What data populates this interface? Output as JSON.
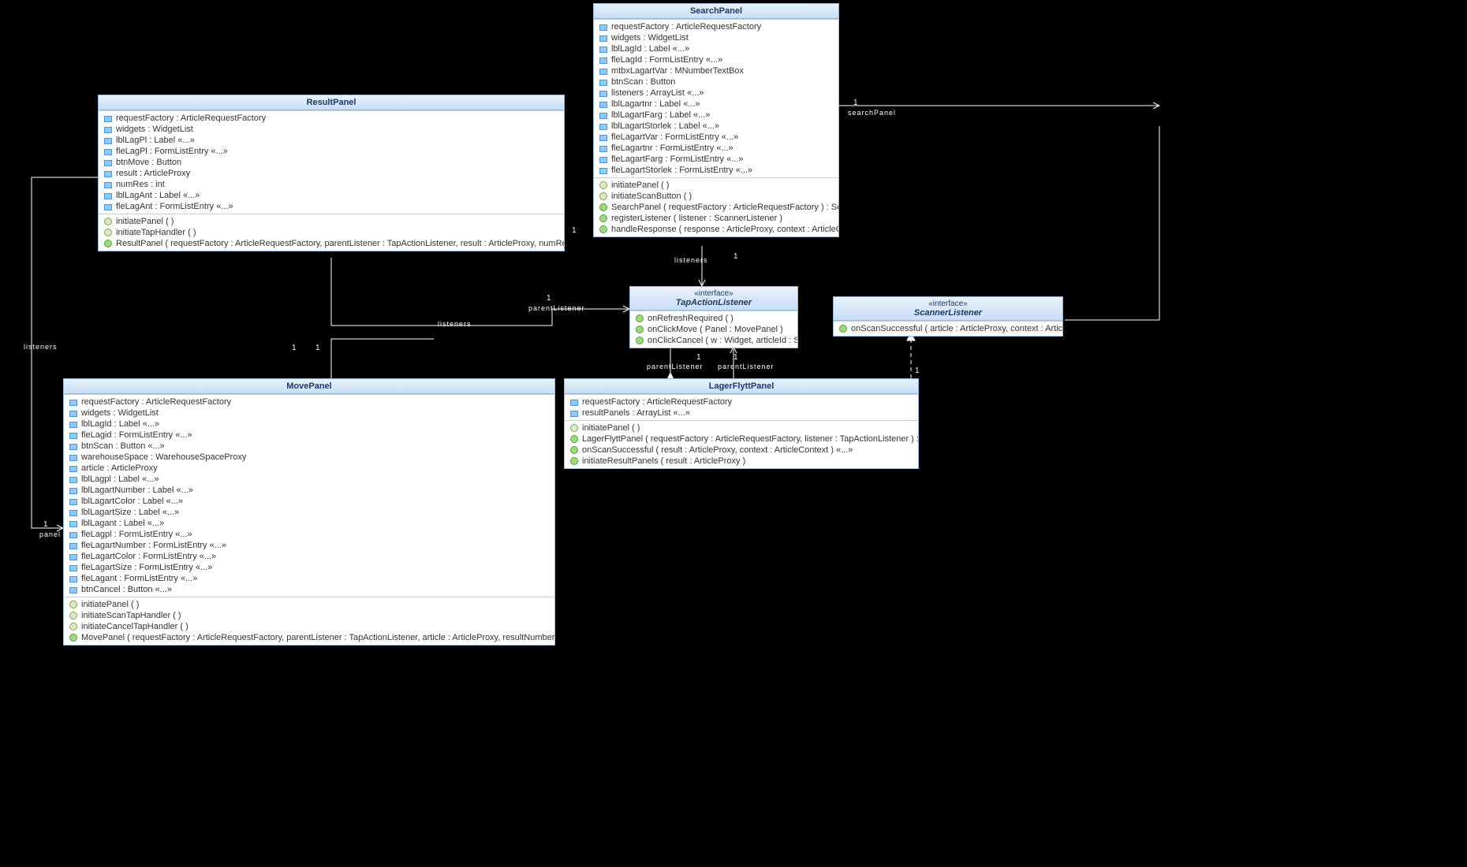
{
  "classes": {
    "ResultPanel": {
      "name": "ResultPanel",
      "fields": [
        "requestFactory : ArticleRequestFactory",
        "widgets : WidgetList",
        "lblLagPl : Label «...»",
        "fleLagPl : FormListEntry «...»",
        "btnMove : Button",
        "result : ArticleProxy",
        "numRes : int",
        "lblLagAnt : Label «...»",
        "fleLagAnt : FormListEntry «...»"
      ],
      "methods": [
        {
          "t": "m",
          "s": "initiatePanel ( )"
        },
        {
          "t": "m",
          "s": "initiateTapHandler ( )"
        },
        {
          "t": "c",
          "s": "ResultPanel ( requestFactory : ArticleRequestFactory, parentListener : TapActionListener, result : ArticleProxy, numRes : int ) :  ResultPanel"
        }
      ]
    },
    "SearchPanel": {
      "name": "SearchPanel",
      "fields": [
        "requestFactory : ArticleRequestFactory",
        "widgets : WidgetList",
        "lblLagId : Label «...»",
        "fleLagId : FormListEntry «...»",
        "mtbxLagartVar : MNumberTextBox",
        "btnScan : Button",
        "listeners : ArrayList «...»",
        "lblLagartnr : Label «...»",
        "lblLagartFarg : Label «...»",
        "lblLagartStorlek : Label «...»",
        "fleLagartVar : FormListEntry «...»",
        "fleLagartnr : FormListEntry «...»",
        "fleLagartFarg : FormListEntry «...»",
        "fleLagartStorlek : FormListEntry «...»"
      ],
      "methods": [
        {
          "t": "m",
          "s": "initiatePanel ( )"
        },
        {
          "t": "m",
          "s": "initiateScanButton ( )"
        },
        {
          "t": "c",
          "s": "SearchPanel ( requestFactory : ArticleRequestFactory ) :  SearchPanel"
        },
        {
          "t": "c",
          "s": "registerListener ( listener : ScannerListener )"
        },
        {
          "t": "c",
          "s": "handleResponse ( response : ArticleProxy, context : ArticleContext )"
        }
      ]
    },
    "TapActionListener": {
      "name": "TapActionListener",
      "stereo": "«interface»",
      "methods": [
        {
          "t": "c",
          "s": "onRefreshRequired ( )"
        },
        {
          "t": "c",
          "s": "onClickMove ( Panel : MovePanel )"
        },
        {
          "t": "c",
          "s": "onClickCancel ( w : Widget, articleId : String )"
        }
      ]
    },
    "ScannerListener": {
      "name": "ScannerListener",
      "stereo": "«interface»",
      "methods": [
        {
          "t": "c",
          "s": "onScanSuccessful ( article : ArticleProxy, context : ArticleContext )"
        }
      ]
    },
    "LagerFlyttPanel": {
      "name": "LagerFlyttPanel",
      "fields": [
        "requestFactory : ArticleRequestFactory",
        "resultPanels : ArrayList «...»"
      ],
      "methods": [
        {
          "t": "m",
          "s": "initiatePanel ( )"
        },
        {
          "t": "c",
          "s": "LagerFlyttPanel ( requestFactory : ArticleRequestFactory, listener : TapActionListener ) :  LagerFlyttPanel"
        },
        {
          "t": "c",
          "s": "onScanSuccessful ( result : ArticleProxy, context : ArticleContext ) «...»"
        },
        {
          "t": "c",
          "s": "initiateResultPanels ( result : ArticleProxy )"
        }
      ]
    },
    "MovePanel": {
      "name": "MovePanel",
      "fields": [
        "requestFactory : ArticleRequestFactory",
        "widgets : WidgetList",
        "lblLagId : Label «...»",
        "fleLagid : FormListEntry «...»",
        "btnScan : Button «...»",
        "warehouseSpace : WarehouseSpaceProxy",
        "article : ArticleProxy",
        "lblLagpl : Label «...»",
        "lblLagartNumber : Label «...»",
        "lblLagartColor : Label «...»",
        "lblLagartSize : Label «...»",
        "lblLagant : Label «...»",
        "fleLagpl : FormListEntry «...»",
        "fleLagartNumber : FormListEntry «...»",
        "fleLagartColor : FormListEntry «...»",
        "fleLagartSize : FormListEntry «...»",
        "fleLagant : FormListEntry «...»",
        "btnCancel : Button «...»"
      ],
      "methods": [
        {
          "t": "m",
          "s": "initiatePanel ( )"
        },
        {
          "t": "m",
          "s": "initiateScanTapHandler ( )"
        },
        {
          "t": "m",
          "s": "initiateCancelTapHandler ( )"
        },
        {
          "t": "c",
          "s": "MovePanel ( requestFactory : ArticleRequestFactory, parentListener : TapActionListener, article : ArticleProxy, resultNumber : int ) :  MovePanel"
        }
      ]
    }
  },
  "edgeLabels": {
    "searchPanel_right": {
      "mult": "1",
      "role": "searchPanel"
    },
    "scanner_right": {
      "mult": "1",
      "role": ""
    },
    "search_to_tap_top": {
      "mult": "1"
    },
    "search_to_tap_btm": {
      "mult": "1",
      "role": "listeners"
    },
    "lager_to_tap_left": {
      "mult": "1",
      "role": "parentListener"
    },
    "lager_to_tap_right": {
      "mult": "1"
    },
    "lager_to_scanner": {
      "mult": "1"
    },
    "result_parent_top": {
      "mult": "1",
      "role": "parentListener"
    },
    "result_parent_left": {
      "mult": "1"
    },
    "move_parent_top": {
      "mult": "1",
      "role": "listeners"
    },
    "move_parent_left": {
      "mult": "1"
    },
    "move_panel_lbl": {
      "mult": "1",
      "role": "panel"
    }
  }
}
